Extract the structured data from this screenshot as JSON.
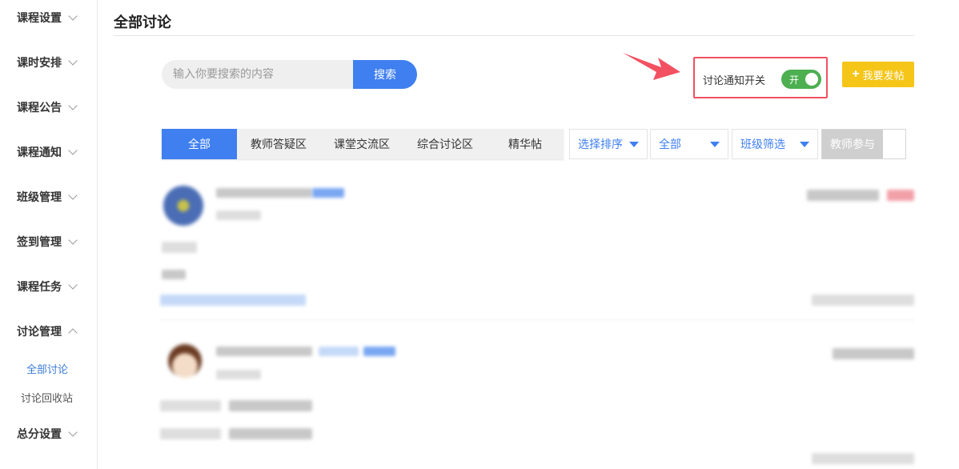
{
  "sidebar": {
    "items": [
      {
        "label": "课程设置",
        "expanded": false
      },
      {
        "label": "课时安排",
        "expanded": false
      },
      {
        "label": "课程公告",
        "expanded": false
      },
      {
        "label": "课程通知",
        "expanded": false
      },
      {
        "label": "班级管理",
        "expanded": false
      },
      {
        "label": "签到管理",
        "expanded": false
      },
      {
        "label": "课程任务",
        "expanded": false
      },
      {
        "label": "讨论管理",
        "expanded": true
      },
      {
        "label": "总分设置",
        "expanded": false
      }
    ],
    "sub_items": [
      {
        "label": "全部讨论",
        "active": true
      },
      {
        "label": "讨论回收站",
        "active": false
      }
    ]
  },
  "header": {
    "title": "全部讨论"
  },
  "search": {
    "placeholder": "输入你要搜索的内容",
    "value": "",
    "button_label": "搜索"
  },
  "notify": {
    "label": "讨论通知开关",
    "toggle_text": "开",
    "on": true
  },
  "post_button": {
    "icon": "plus-icon",
    "label": "我要发帖"
  },
  "tabs": [
    {
      "label": "全部",
      "active": true
    },
    {
      "label": "教师答疑区",
      "active": false
    },
    {
      "label": "课堂交流区",
      "active": false
    },
    {
      "label": "综合讨论区",
      "active": false
    },
    {
      "label": "精华帖",
      "active": false
    }
  ],
  "filters": {
    "sort": "选择排序",
    "scope": "全部",
    "class": "班级筛选",
    "teacher_join": "教师参与"
  },
  "colors": {
    "accent": "#3f7ff0",
    "toggle_on": "#4caf50",
    "post_button": "#f5c518",
    "annotation": "#f25162"
  }
}
